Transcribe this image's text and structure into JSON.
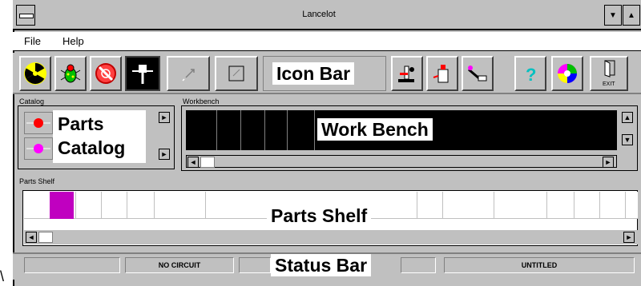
{
  "window": {
    "title": "Lancelot"
  },
  "title_buttons": {
    "minimize": "▼",
    "maximize": "▲"
  },
  "menu": {
    "items": [
      "File",
      "Help"
    ]
  },
  "iconbar": {
    "label": "Icon Bar",
    "icons": [
      "radiation-icon",
      "bug-icon",
      "no-entry-icon",
      "hammer-icon",
      "pointer-icon",
      "checkbox-icon",
      "microscope-icon",
      "bottle-icon",
      "tools-icon",
      "help-icon",
      "color-wheel-icon",
      "exit-icon"
    ],
    "exit_text": "EXIT"
  },
  "catalog": {
    "section_label": "Catalog",
    "label_line1": "Parts",
    "label_line2": "Catalog",
    "scroll_right": "►"
  },
  "workbench": {
    "section_label": "Workbench",
    "label": "Work Bench",
    "scroll_left": "◄",
    "scroll_right": "►",
    "scroll_up": "▲",
    "scroll_down": "▼"
  },
  "shelf": {
    "section_label": "Parts Shelf",
    "label": "Parts Shelf",
    "scroll_left": "◄",
    "scroll_right": "►",
    "selected_color": "#c000c0"
  },
  "status": {
    "label": "Status Bar",
    "panels": [
      "",
      "NO CIRCUIT",
      "",
      "",
      "UNTITLED"
    ]
  },
  "colors": {
    "face": "#c0c0c0",
    "workbench": "#000000",
    "accent": "#c000c0",
    "catalog_dot1": "#ff0000",
    "catalog_dot2": "#ff00ff"
  }
}
